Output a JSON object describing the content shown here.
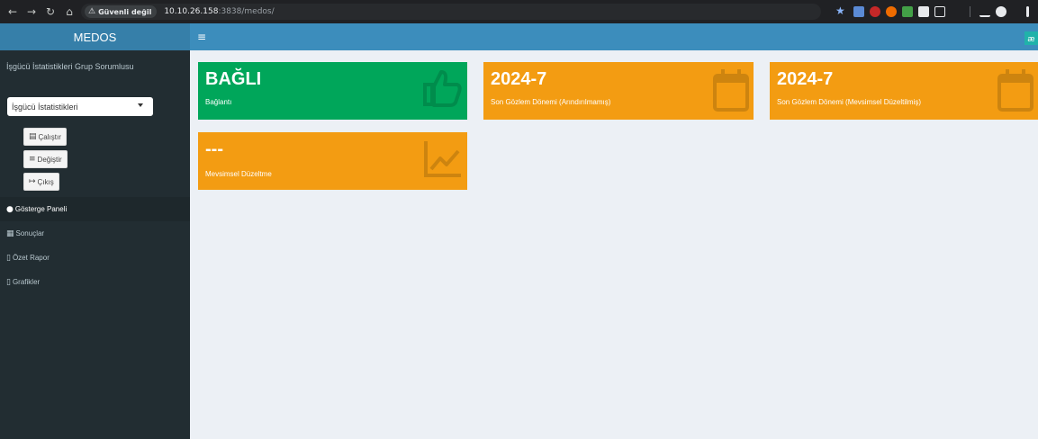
{
  "browser": {
    "security_chip": "Güvenli değil",
    "url_host": "10.10.26.158",
    "url_rest": ":3838/medos/",
    "nav_icons": [
      "back-arrow-icon",
      "forward-arrow-icon",
      "reload-icon",
      "home-icon"
    ],
    "extension_icons": [
      "ext-1",
      "ext-2",
      "ext-3",
      "ext-4",
      "ext-5",
      "ext-6",
      "puzzle-icon",
      "download-icon",
      "profile-icon"
    ]
  },
  "sidebar": {
    "logo": "MEDOS",
    "caption": "İşgücü İstatistikleri Grup Sorumlusu",
    "select_value": "İşgücü İstatistikleri",
    "buttons": [
      {
        "label": "Çalıştır",
        "icon": "calculator-icon"
      },
      {
        "label": "Değiştir",
        "icon": "bars-icon"
      },
      {
        "label": "Çıkış",
        "icon": "sign-out-icon"
      }
    ],
    "menu": [
      {
        "label": "Gösterge Paneli",
        "icon": "info-circle-icon",
        "active": true
      },
      {
        "label": "Sonuçlar",
        "icon": "table-icon",
        "active": false
      },
      {
        "label": "Özet Rapor",
        "icon": "file-icon",
        "active": false
      },
      {
        "label": "Grafikler",
        "icon": "file-icon",
        "active": false
      }
    ]
  },
  "navbar": {
    "toggle_icon": "hamburger-icon",
    "right_badge": "æ"
  },
  "value_boxes": [
    {
      "value": "BAĞLI",
      "subtitle": "Bağlantı",
      "icon": "thumbs-up-icon",
      "color": "#00a65a"
    },
    {
      "value": "2024-7",
      "subtitle": "Son Gözlem Dönemi (Arındırılmamış)",
      "icon": "calendar-icon",
      "color": "#f39c12"
    },
    {
      "value": "2024-7",
      "subtitle": "Son Gözlem Dönemi (Mevsimsel Düzeltilmiş)",
      "icon": "calendar-icon",
      "color": "#f39c12"
    },
    {
      "value": "---",
      "subtitle": "Mevsimsel Düzeltme",
      "icon": "line-chart-icon",
      "color": "#f39c12"
    }
  ],
  "colors": {
    "sidebar_bg": "#222d32",
    "header_blue": "#3c8dbc",
    "logo_blue": "#367fa9",
    "content_bg": "#ecf0f5"
  }
}
